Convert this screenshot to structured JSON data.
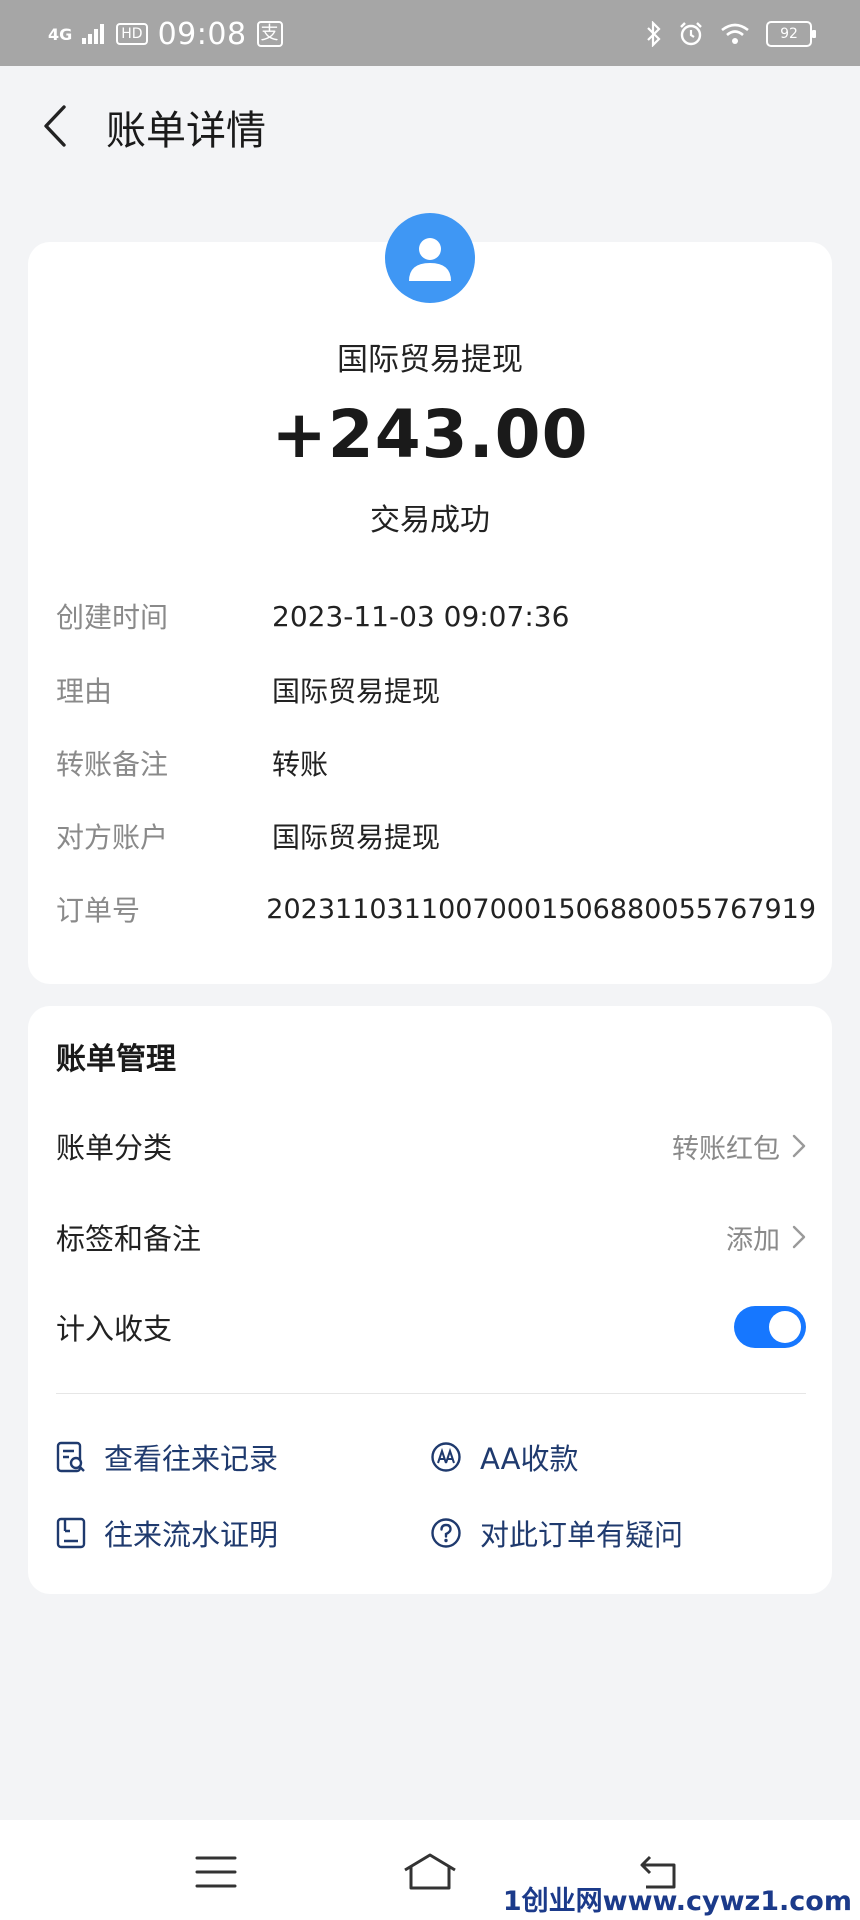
{
  "status_bar": {
    "network": "4G",
    "hd": "HD",
    "time": "09:08",
    "app_badge": "支",
    "battery": "92"
  },
  "header": {
    "title": "账单详情"
  },
  "transaction": {
    "payee": "国际贸易提现",
    "amount": "+243.00",
    "status": "交易成功"
  },
  "details": [
    {
      "label": "创建时间",
      "value": "2023-11-03 09:07:36"
    },
    {
      "label": "理由",
      "value": "国际贸易提现"
    },
    {
      "label": "转账备注",
      "value": "转账"
    },
    {
      "label": "对方账户",
      "value": "国际贸易提现"
    },
    {
      "label": "订单号",
      "value": "20231103110070001506880055767919"
    }
  ],
  "management": {
    "title": "账单管理",
    "category": {
      "label": "账单分类",
      "value": "转账红包"
    },
    "tags": {
      "label": "标签和备注",
      "value": "添加"
    },
    "count_in": {
      "label": "计入收支",
      "enabled": true
    }
  },
  "links": {
    "records": "查看往来记录",
    "aa": "AA收款",
    "proof": "往来流水证明",
    "question": "对此订单有疑问"
  },
  "watermark": "1创业网www.cywz1.com",
  "colors": {
    "accent": "#1677ff",
    "avatar": "#3f97f4",
    "link_text": "#1f3a6e"
  }
}
